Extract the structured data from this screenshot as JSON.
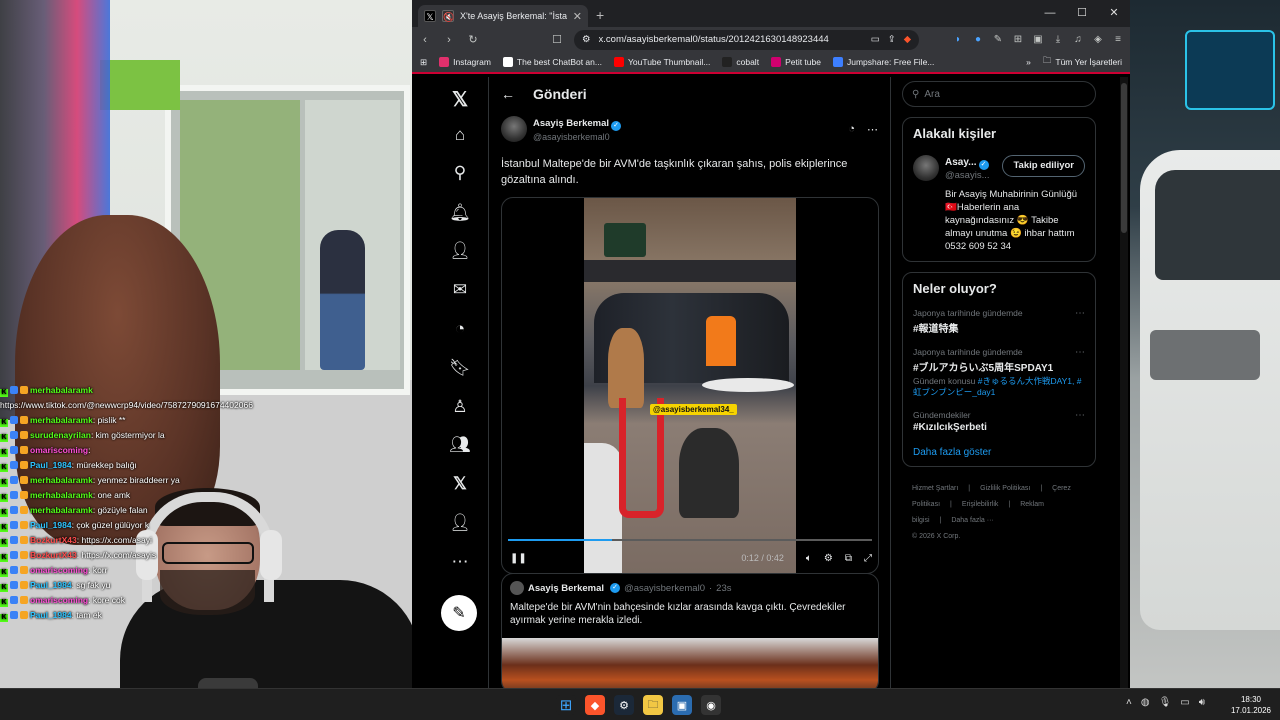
{
  "browser": {
    "tab_title": "X'te Asayiş Berkemal: \"İstanbul",
    "url": "x.com/asayisberkemal0/status/2012421630148923444",
    "new_tab": "+",
    "bookmarks": [
      {
        "label": "Instagram",
        "color": "#e1306c"
      },
      {
        "label": "The best ChatBot an...",
        "color": "#ffffff"
      },
      {
        "label": "YouTube Thumbnail...",
        "color": "#ff0000"
      },
      {
        "label": "cobalt",
        "color": "#222222"
      },
      {
        "label": "Petit tube",
        "color": "#d0006f"
      },
      {
        "label": "Jumpshare: Free File...",
        "color": "#3d7fff"
      }
    ],
    "bookmarks_more": "»",
    "all_bookmarks": "Tüm Yer İşaretleri"
  },
  "x": {
    "header_title": "Gönderi",
    "post": {
      "display_name": "Asayiş Berkemal",
      "handle": "@asayisberkemal0",
      "text": "İstanbul Maltepe'de bir AVM'de taşkınlık çıkaran şahıs, polis ekiplerince gözaltına alındı.",
      "video_watermark": "@asayisberkemal34_",
      "video_time": "0:12 / 0:42",
      "video_progress": 0.286
    },
    "quote": {
      "display_name": "Asayiş Berkemal",
      "handle": "@asayisberkemal0",
      "age": "23s",
      "text": "Maltepe'de bir AVM'nin bahçesinde kızlar arasında kavga çıktı. Çevredekiler ayırmak yerine merakla izledi."
    },
    "search_placeholder": "Ara",
    "related": {
      "title": "Alakalı kişiler",
      "name": "Asay...",
      "handle": "@asayis...",
      "follow_label": "Takip ediliyor",
      "bio": "Bir Asayiş Muhabirinin Günlüğü 🇹🇷Haberlerin ana kaynağındasınız 😎 Takibe almayı unutma 😉 ihbar hattım 0532 609 52 34"
    },
    "trends": {
      "title": "Neler oluyor?",
      "items": [
        {
          "context": "Japonya tarihinde gündemde",
          "name": "#報道特集",
          "sub": "",
          "sub_link": ""
        },
        {
          "context": "Japonya tarihinde gündemde",
          "name": "#ブルアカらいぶ5周年SPDAY1",
          "sub": "Gündem konusu ",
          "sub_link": "#きゅるるん大作戦DAY1, #虹ブンブンピー_day1"
        },
        {
          "context": "Gündemdekiler",
          "name": "#KızılcıkŞerbeti",
          "sub": "",
          "sub_link": ""
        }
      ],
      "show_more": "Daha fazla göster"
    },
    "footer": {
      "links": [
        "Hizmet Şartları",
        "|",
        "Gizlilik Politikası",
        "|",
        "Çerez Politikası",
        "|",
        "Erişilebilirlik",
        "|",
        "Reklam bilgisi",
        "|",
        "Daha fazla ···"
      ],
      "copyright": "© 2026 X Corp."
    }
  },
  "chat": [
    {
      "user": "merhabalaramk",
      "msg": "",
      "color": "#53fc18"
    },
    {
      "user": "",
      "msg": "https://www.tiktok.com/@newwcrp94/video/7587279091674402066",
      "color": "#ffffff"
    },
    {
      "user": "merhabalaramk",
      "msg": ": pislik **",
      "color": "#53fc18"
    },
    {
      "user": "surudenayrilan",
      "msg": ": kim göstermiyor la",
      "color": "#53fc18"
    },
    {
      "user": "omariscoming",
      "msg": ":",
      "color": "#ff4fd8"
    },
    {
      "user": "Paul_1984",
      "msg": ": mürekkep balığı",
      "color": "#2ec4ff"
    },
    {
      "user": "merhabalaramk",
      "msg": ": yenmez biraddeerr ya",
      "color": "#53fc18"
    },
    {
      "user": "merhabalaramk",
      "msg": ": one amk",
      "color": "#53fc18"
    },
    {
      "user": "merhabalaramk",
      "msg": ": gözüyle falan",
      "color": "#53fc18"
    },
    {
      "user": "Paul_1984",
      "msg": ": çok güzel gülüyor k",
      "color": "#2ec4ff"
    },
    {
      "user": "BozkurtX43",
      "msg": ": https://x.com/asayi",
      "color": "#ff4d4d"
    },
    {
      "user": "BozkurtX43",
      "msg": ": https://x.com/asayis",
      "color": "#ff4d4d"
    },
    {
      "user": "omariscoming",
      "msg": ": korr",
      "color": "#ff4fd8"
    },
    {
      "user": "Paul_1984",
      "msg": ": sg fak yu",
      "color": "#2ec4ff"
    },
    {
      "user": "omariscoming",
      "msg": ": kore cok",
      "color": "#ff4fd8"
    },
    {
      "user": "Paul_1984",
      "msg": ": tam ek",
      "color": "#2ec4ff"
    }
  ],
  "taskbar": {
    "time": "18:30",
    "date": "17.01.2026"
  }
}
